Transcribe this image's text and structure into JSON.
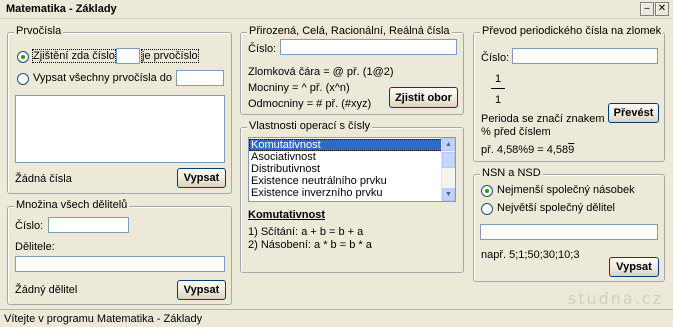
{
  "window": {
    "title": "Matematika - Základy",
    "minimize_symbol": "–",
    "close_symbol": "✕"
  },
  "prime": {
    "legend": "Prvočísla",
    "check_label": "Zjištění zda číslo",
    "check_suffix": "je prvočíslo",
    "check_value": "",
    "list_label": "Vypsat všechny prvočísla do",
    "list_value": "",
    "empty_text": "Žádná čísla",
    "button": "Vypsat"
  },
  "divisors": {
    "legend": "Množina všech dělitelů",
    "number_label": "Číslo:",
    "number_value": "",
    "divisors_label": "Dělitele:",
    "divisors_value": "",
    "empty_text": "Žádný dělitel",
    "button": "Vypsat"
  },
  "domain": {
    "legend": "Přirozená, Celá, Racionální, Reálná čísla",
    "number_label": "Číslo:",
    "number_value": "",
    "hint_fraction": "Zlomková čára = @ př. (1@2)",
    "hint_power": "Mocniny = ^ př. (x^n)",
    "hint_root": "Odmocniny = # př. (#xyz)",
    "button": "Zjistit obor"
  },
  "operations": {
    "legend": "Vlastnosti operací s čísly",
    "items": [
      "Komutativnost",
      "Asociativnost",
      "Distributivnost",
      "Existence neutrálního prvku",
      "Existence inverzního prvku"
    ],
    "selected_index": 0,
    "detail_title": "Komutativnost",
    "detail_line1": "1) Sčítání: a + b = b + a",
    "detail_line2": "2) Násobení: a * b = b * a"
  },
  "periodic": {
    "legend": "Převod periodického čísla na zlomek",
    "number_label": "Číslo:",
    "number_value": "",
    "numerator": "1",
    "denominator": "1",
    "note": "Perioda se značí znakem\n% před číslem",
    "example_prefix": "př. 4,58%9 = 4,58",
    "example_period": "9",
    "button": "Převést"
  },
  "gcd_lcm": {
    "legend": "NSN a NSD",
    "option_lcm": "Nejmenší společný násobek",
    "option_gcd": "Největší společný dělitel",
    "selected": "lcm",
    "input_value": "",
    "example": "např. 5;1;50;30;10;3",
    "button": "Vypsat"
  },
  "status": {
    "text": "Vítejte v programu Matematika - Základy"
  },
  "watermark": "studna.cz"
}
